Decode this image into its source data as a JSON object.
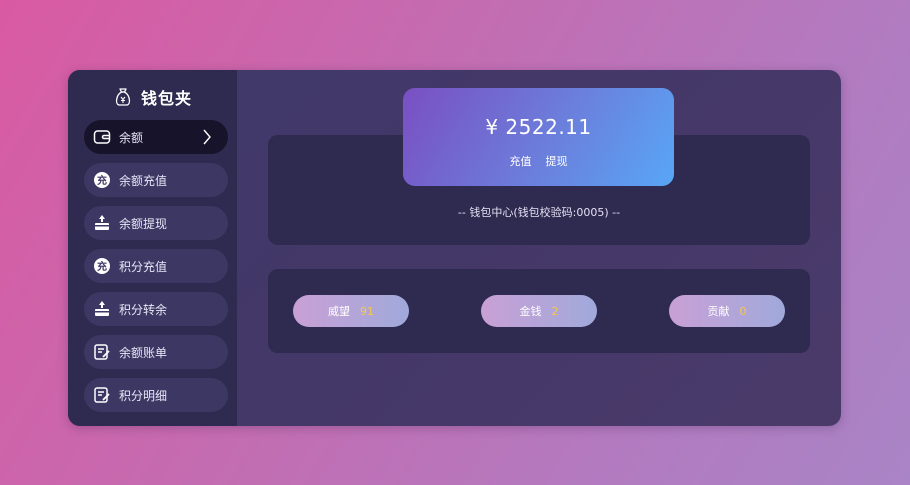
{
  "app": {
    "title": "钱包夹",
    "icon": "money-bag-icon"
  },
  "sidebar": {
    "items": [
      {
        "label": "余额",
        "icon": "wallet-icon",
        "active": true
      },
      {
        "label": "余额充值",
        "icon": "recharge-badge-icon"
      },
      {
        "label": "余额提现",
        "icon": "withdraw-icon"
      },
      {
        "label": "积分充值",
        "icon": "recharge-badge-icon"
      },
      {
        "label": "积分转余",
        "icon": "transfer-icon"
      },
      {
        "label": "余额账单",
        "icon": "bill-icon"
      },
      {
        "label": "积分明细",
        "icon": "detail-icon"
      }
    ]
  },
  "wallet": {
    "amount": "¥ 2522.11",
    "recharge_label": "充值",
    "withdraw_label": "提现",
    "caption": "-- 钱包中心(钱包校验码:0005) --"
  },
  "stats": [
    {
      "label": "威望",
      "value": "91"
    },
    {
      "label": "金钱",
      "value": "2"
    },
    {
      "label": "贡献",
      "value": "0"
    }
  ],
  "colors": {
    "accent_value": "#f7c948",
    "card_gradient_start": "#7a4fc2",
    "card_gradient_end": "#58a6f6",
    "sidebar_bg": "#2f2a4f"
  }
}
